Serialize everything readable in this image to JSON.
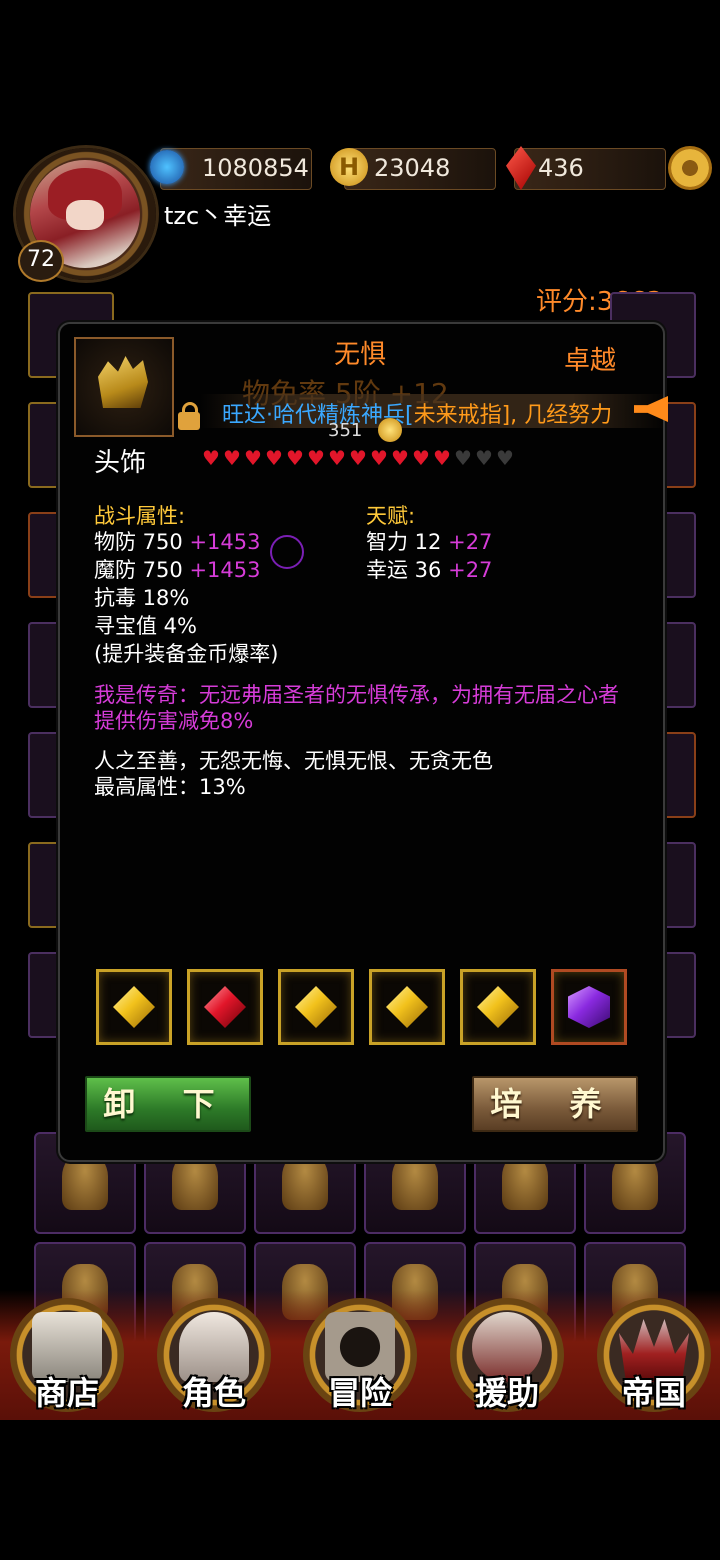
{
  "player": {
    "level": "72",
    "name": "tzc丶幸运",
    "power": "1080854",
    "gold": "23048",
    "gems": "436"
  },
  "score": "评分:3663",
  "item": {
    "name": "无惧",
    "quality": "卓越",
    "type_faded": "物免率 5阶 +12",
    "sell_price": "351",
    "slot_label": "头饰",
    "hearts_filled": 12,
    "hearts_total": 15
  },
  "marquee": {
    "part1": "旺达·哈代精炼神兵[",
    "item": "未来戒指",
    "part2": "], 几经努力"
  },
  "combat": {
    "title": "战斗属性:",
    "lines": [
      {
        "label": "物防 750",
        "bonus": "+1453"
      },
      {
        "label": "魔防 750",
        "bonus": "+1453"
      },
      {
        "label": "抗毒 18%",
        "bonus": ""
      },
      {
        "label": "寻宝值 4%",
        "bonus": ""
      },
      {
        "label": "(提升装备金币爆率)",
        "bonus": ""
      }
    ]
  },
  "talent": {
    "title": "天赋:",
    "lines": [
      {
        "label": "智力 12",
        "bonus": "+27"
      },
      {
        "label": "幸运 36",
        "bonus": "+27"
      }
    ]
  },
  "legend_text": "我是传奇：无远弗届圣者的无惧传承，为拥有无届之心者提供伤害减免8%",
  "flavor": {
    "line1": "人之至善，无怨无悔、无惧无恨、无贪无色",
    "line2": "最高属性：13%"
  },
  "gems": [
    "yellow",
    "red",
    "yellow",
    "yellow",
    "yellow",
    "purple"
  ],
  "buttons": {
    "unequip": "卸 下",
    "train": "培 养"
  },
  "nav": [
    {
      "label": "商店",
      "icon": "castle-icon"
    },
    {
      "label": "角色",
      "icon": "hooded-figure-icon"
    },
    {
      "label": "冒险",
      "icon": "dungeon-gate-icon"
    },
    {
      "label": "援助",
      "icon": "helper-portrait-icon"
    },
    {
      "label": "帝国",
      "icon": "crown-icon"
    }
  ],
  "colors": {
    "orange": "#ff8a2a",
    "bonus_magenta": "#d63cd8",
    "section_gold": "#ffc93a",
    "heart_red": "#e2162a"
  }
}
